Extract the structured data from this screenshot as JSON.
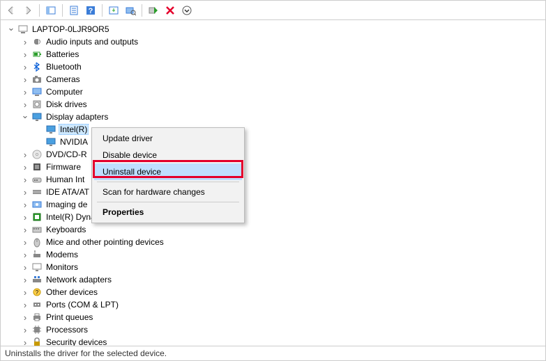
{
  "toolbar": {
    "back": "back",
    "forward": "forward",
    "btns": [
      "view",
      "details",
      "help",
      "update",
      "scan",
      "add",
      "remove",
      "more"
    ]
  },
  "root": {
    "label": "LAPTOP-0LJR9OR5"
  },
  "categories": [
    {
      "label": "Audio inputs and outputs",
      "icon": "audio",
      "state": "closed"
    },
    {
      "label": "Batteries",
      "icon": "battery",
      "state": "closed"
    },
    {
      "label": "Bluetooth",
      "icon": "bluetooth",
      "state": "closed"
    },
    {
      "label": "Cameras",
      "icon": "camera",
      "state": "closed"
    },
    {
      "label": "Computer",
      "icon": "computer",
      "state": "closed"
    },
    {
      "label": "Disk drives",
      "icon": "disk",
      "state": "closed"
    },
    {
      "label": "Display adapters",
      "icon": "display",
      "state": "open",
      "children": [
        {
          "label": "Intel(R)",
          "icon": "display",
          "selected": true
        },
        {
          "label": "NVIDIA",
          "icon": "display"
        }
      ]
    },
    {
      "label": "DVD/CD-R",
      "icon": "dvd",
      "state": "closed",
      "truncated": true
    },
    {
      "label": "Firmware",
      "icon": "firmware",
      "state": "closed"
    },
    {
      "label": "Human Int",
      "icon": "hid",
      "state": "closed",
      "truncated": true
    },
    {
      "label": "IDE ATA/AT",
      "icon": "ide",
      "state": "closed",
      "truncated": true
    },
    {
      "label": "Imaging de",
      "icon": "imaging",
      "state": "closed",
      "truncated": true
    },
    {
      "label": "Intel(R) Dynamic Platform and Thermal Framework",
      "icon": "intel",
      "state": "closed"
    },
    {
      "label": "Keyboards",
      "icon": "keyboard",
      "state": "closed"
    },
    {
      "label": "Mice and other pointing devices",
      "icon": "mouse",
      "state": "closed"
    },
    {
      "label": "Modems",
      "icon": "modem",
      "state": "closed"
    },
    {
      "label": "Monitors",
      "icon": "monitor",
      "state": "closed"
    },
    {
      "label": "Network adapters",
      "icon": "network",
      "state": "closed"
    },
    {
      "label": "Other devices",
      "icon": "other",
      "state": "closed"
    },
    {
      "label": "Ports (COM & LPT)",
      "icon": "port",
      "state": "closed"
    },
    {
      "label": "Print queues",
      "icon": "printer",
      "state": "closed"
    },
    {
      "label": "Processors",
      "icon": "cpu",
      "state": "closed"
    },
    {
      "label": "Security devices",
      "icon": "security",
      "state": "closed"
    }
  ],
  "menu": {
    "items": [
      {
        "label": "Update driver"
      },
      {
        "label": "Disable device"
      },
      {
        "label": "Uninstall device",
        "hover": true,
        "highlight": true
      },
      {
        "sep": true
      },
      {
        "label": "Scan for hardware changes"
      },
      {
        "sep": true
      },
      {
        "label": "Properties",
        "bold": true
      }
    ]
  },
  "status": {
    "text": "Uninstalls the driver for the selected device."
  }
}
